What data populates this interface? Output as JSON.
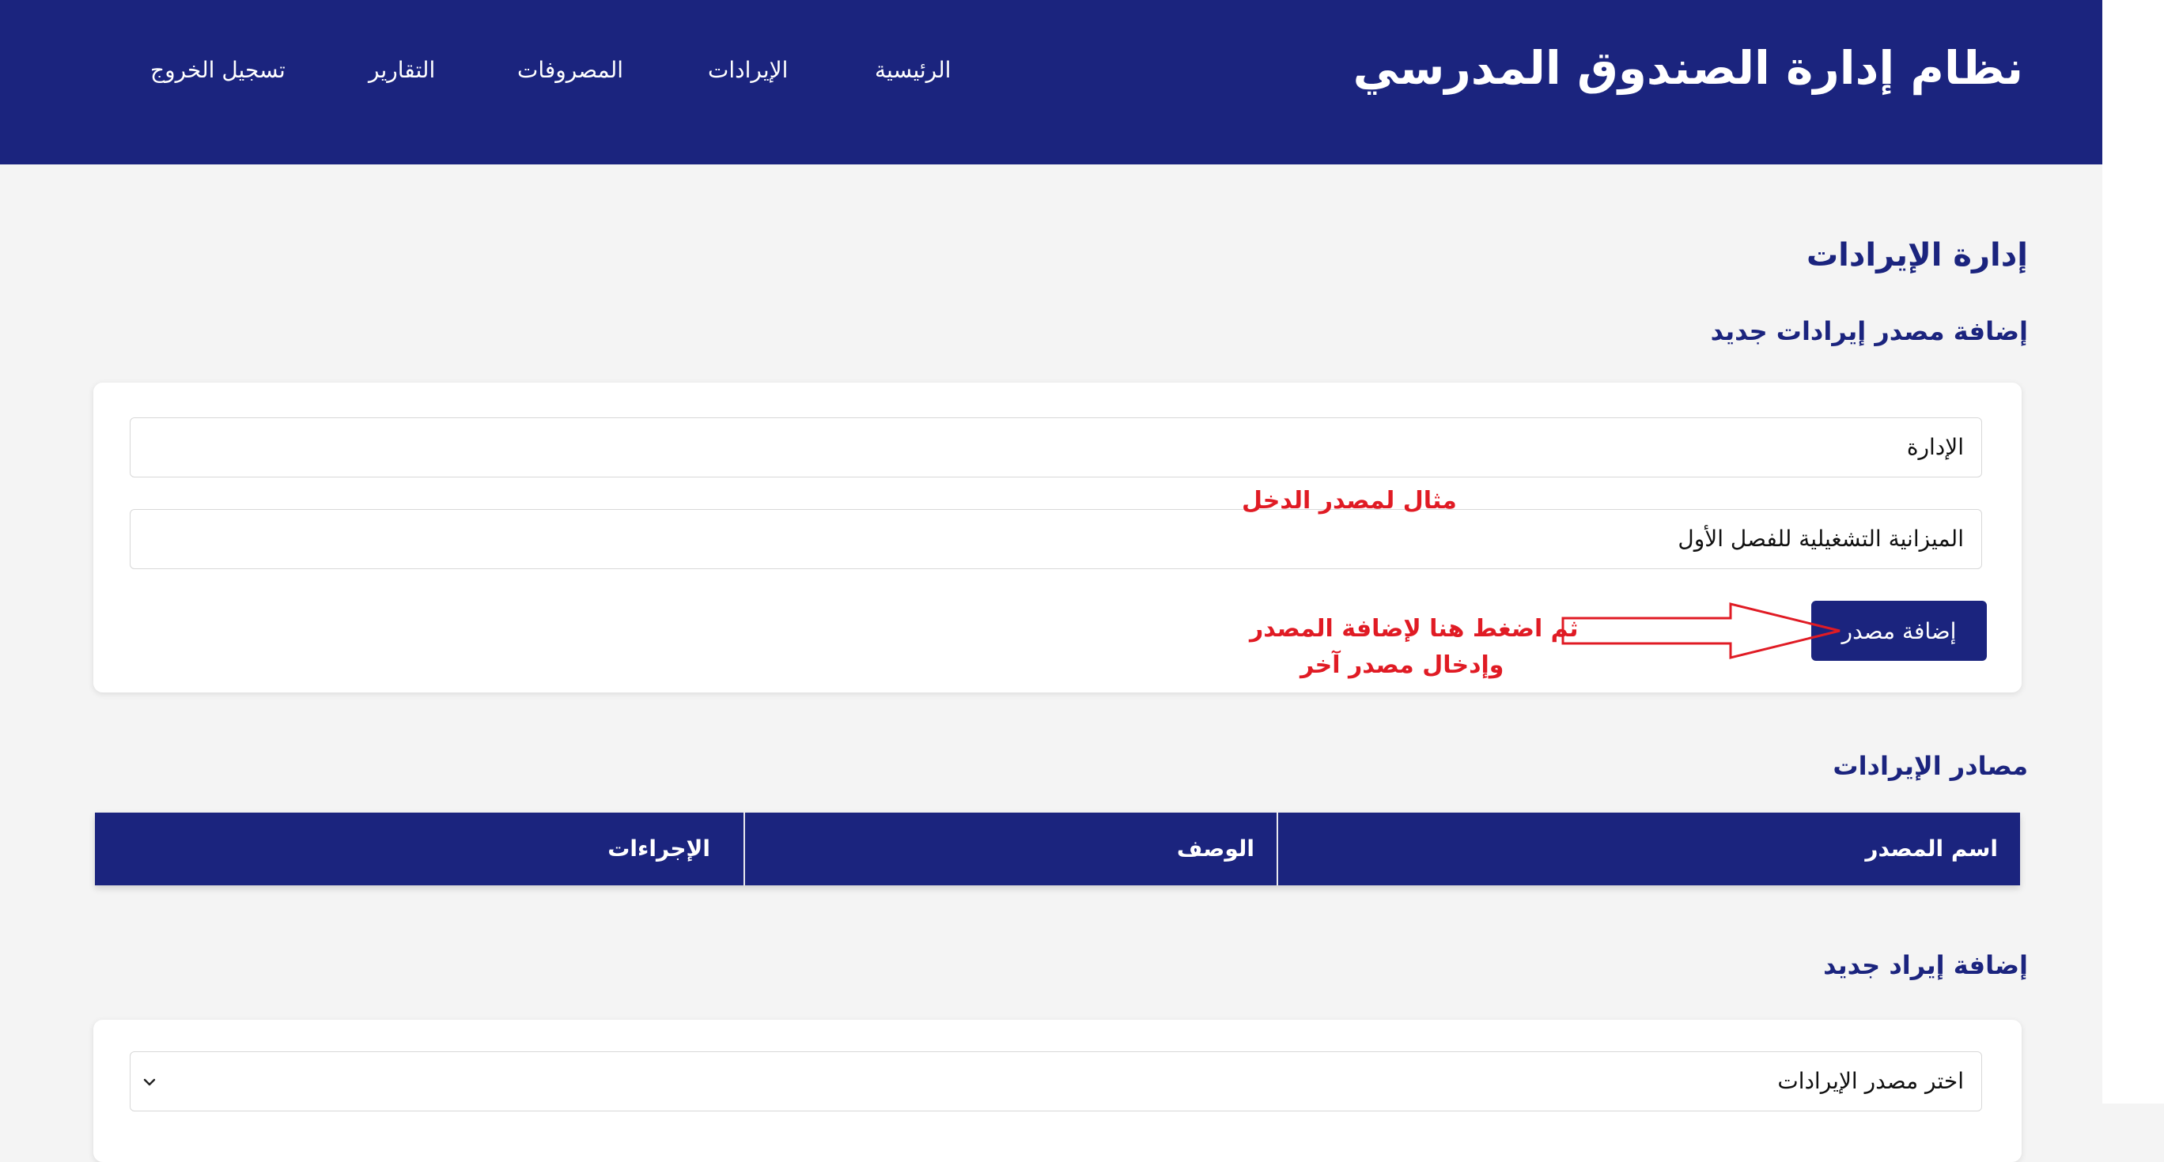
{
  "header": {
    "title": "نظام إدارة الصندوق المدرسي",
    "nav": [
      "الرئيسية",
      "الإيرادات",
      "المصروفات",
      "التقارير",
      "تسجيل الخروج"
    ]
  },
  "page": {
    "title": "إدارة الإيرادات",
    "add_source_heading": "إضافة مصدر إيرادات جديد",
    "sources_heading": "مصادر الإيرادات",
    "add_income_heading": "إضافة إيراد جديد"
  },
  "source_form": {
    "name_value": "الإدارة",
    "description_value": "الميزانية التشغيلية للفصل الأول",
    "submit_label": "إضافة مصدر"
  },
  "annotations": {
    "example": "مثال لمصدر الدخل",
    "instruction_line1": "ثم اضغط هنا لإضافة المصدر",
    "instruction_line2": "وإدخال مصدر آخر"
  },
  "sources_table": {
    "columns": [
      "اسم المصدر",
      "الوصف",
      "الإجراءات"
    ]
  },
  "income_form": {
    "source_select_value": "اختر مصدر الإيرادات"
  },
  "colors": {
    "primary": "#1b247e",
    "annotation": "#e01b24",
    "background": "#f4f4f4"
  }
}
